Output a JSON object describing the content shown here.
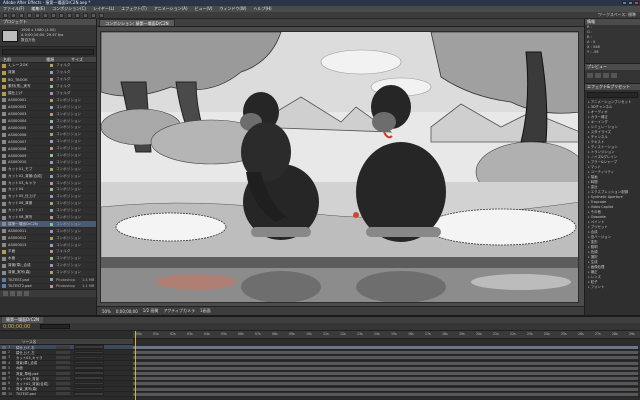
{
  "window": {
    "title": "Adobe After Effects - 猿第一場面DrC2N.aep *"
  },
  "menu": [
    "ファイル(F)",
    "編集(E)",
    "コンポジション(C)",
    "レイヤー(L)",
    "エフェクト(T)",
    "アニメーション(A)",
    "ビュー(V)",
    "ウィンドウ(W)",
    "ヘルプ(H)"
  ],
  "toolbar": {
    "workspace": "ワークスペース: 標準"
  },
  "project": {
    "tab": "プロジェクト",
    "thumb_info": [
      "1920 x 1080 (1.00)",
      "Δ 0;00;10;00, 29.97 fps",
      "数百万色"
    ],
    "headers": [
      "名前",
      "種類",
      "サイズ"
    ],
    "items": [
      {
        "name": "1_レースOK",
        "type": "フォルダ",
        "size": ""
      },
      {
        "name": "背景",
        "type": "フォルダ",
        "size": ""
      },
      {
        "name": "BG_TBOOK",
        "type": "フォルダ",
        "size": ""
      },
      {
        "name": "素材(別)_実写",
        "type": "フォルダ",
        "size": ""
      },
      {
        "name": "猿仕上げ",
        "type": "フォルダ",
        "size": ""
      },
      {
        "name": "AS000001",
        "type": "コンポジション",
        "size": ""
      },
      {
        "name": "AS000002",
        "type": "コンポジション",
        "size": ""
      },
      {
        "name": "AS000003",
        "type": "コンポジション",
        "size": ""
      },
      {
        "name": "AS000004",
        "type": "コンポジション",
        "size": ""
      },
      {
        "name": "AS000005",
        "type": "コンポジション",
        "size": ""
      },
      {
        "name": "AS000006",
        "type": "コンポジション",
        "size": ""
      },
      {
        "name": "AS000007",
        "type": "コンポジション",
        "size": ""
      },
      {
        "name": "AS000008",
        "type": "コンポジション",
        "size": ""
      },
      {
        "name": "AS000009",
        "type": "コンポジション",
        "size": ""
      },
      {
        "name": "AS000010",
        "type": "コンポジション",
        "size": ""
      },
      {
        "name": "カット01_モブ",
        "type": "コンポジション",
        "size": ""
      },
      {
        "name": "カット02_背景(合成)",
        "type": "コンポジション",
        "size": ""
      },
      {
        "name": "カット03_キャラ",
        "type": "コンポジション",
        "size": ""
      },
      {
        "name": "カット04",
        "type": "コンポジション",
        "size": ""
      },
      {
        "name": "カット05_仕上げ",
        "type": "コンポジション",
        "size": ""
      },
      {
        "name": "カット06_背景",
        "type": "コンポジション",
        "size": ""
      },
      {
        "name": "カット07",
        "type": "コンポジション",
        "size": ""
      },
      {
        "name": "カット08_実写",
        "type": "コンポジション",
        "size": ""
      },
      {
        "name": "猿第一場面DrC2N",
        "type": "コンポジション",
        "size": ""
      },
      {
        "name": "AS000011",
        "type": "コンポジション",
        "size": ""
      },
      {
        "name": "AS000012",
        "type": "コンポジション",
        "size": ""
      },
      {
        "name": "AS000013",
        "type": "コンポジション",
        "size": ""
      },
      {
        "name": "平面",
        "type": "フォルダ",
        "size": ""
      },
      {
        "name": "水面",
        "type": "コンポジション",
        "size": ""
      },
      {
        "name": "背景(草)_合成",
        "type": "コンポジション",
        "size": ""
      },
      {
        "name": "背景_実写(森)",
        "type": "コンポジション",
        "size": ""
      },
      {
        "name": "TILTEST.psd",
        "type": "Photoshop",
        "size": "1.4 MB"
      },
      {
        "name": "TILTEST2.psd",
        "type": "Photoshop",
        "size": "1.1 MB"
      },
      {
        "name": "背景_草地.psd",
        "type": "Photoshop",
        "size": "2.3 MB"
      }
    ]
  },
  "composition": {
    "tab": "コンポジション: 猿第一場面DrC2N",
    "zoom": "50%",
    "timecode": "0;00;00;00",
    "resolution": "1/2 画質",
    "camera": "アクティブカメラ",
    "view": "1画面"
  },
  "info_panel": {
    "title": "情報",
    "lines": [
      "R : ",
      "G : ",
      "B : ",
      "A : 0",
      "X : 548",
      "Y : -56"
    ]
  },
  "preview_panel": {
    "title": "プレビュー"
  },
  "effects_panel": {
    "title": "エフェクト&プリセット",
    "items": [
      "アニメーションプリセット",
      "3Dチャンネル",
      "オーディオ",
      "カラー補正",
      "キーイング",
      "シミュレーション",
      "スタイライズ",
      "チャンネル",
      "テキスト",
      "ディストーション",
      "トランジション",
      "ノイズ&グレイン",
      "ブラー&シャープ",
      "マット",
      "ユーティリティ",
      "描画",
      "時間",
      "遠近",
      "エクスプレッション制御",
      "Synthetic Aperture",
      "Trapcode",
      "Video Copilot",
      "その他",
      "Obsolete",
      "ペイント",
      "プリセット",
      "合成",
      "旧バージョン",
      "変形",
      "照明",
      "色調",
      "選択",
      "生成",
      "画像処理",
      "補正",
      "レンズ",
      "粒子",
      "フォント"
    ]
  },
  "timeline": {
    "tab": "猿第一場面DrC2N",
    "timecode": "0;00;00;00",
    "layer_header": "ソース名",
    "ticks": [
      "00s",
      "01s",
      "02s",
      "03s",
      "04s",
      "05s",
      "06s",
      "07s",
      "08s",
      "09s",
      "10s",
      "11s",
      "12s",
      "13s",
      "14s",
      "15s",
      "16s",
      "17s",
      "18s",
      "19s",
      "20s",
      "21s",
      "22s",
      "23s",
      "24s",
      "25s",
      "26s",
      "27s",
      "28s",
      "29s"
    ],
    "layers": [
      {
        "num": "1",
        "name": "猿仕上げ_右"
      },
      {
        "num": "2",
        "name": "猿仕上げ_左"
      },
      {
        "num": "3",
        "name": "カット03_キャラ"
      },
      {
        "num": "4",
        "name": "背景(草)_合成"
      },
      {
        "num": "5",
        "name": "水面"
      },
      {
        "num": "6",
        "name": "背景_草地.psd"
      },
      {
        "num": "7",
        "name": "カット06_背景"
      },
      {
        "num": "8",
        "name": "カット02_背景(合成)"
      },
      {
        "num": "9",
        "name": "背景_実写(森)"
      },
      {
        "num": "10",
        "name": "TILTEST.psd"
      }
    ]
  }
}
